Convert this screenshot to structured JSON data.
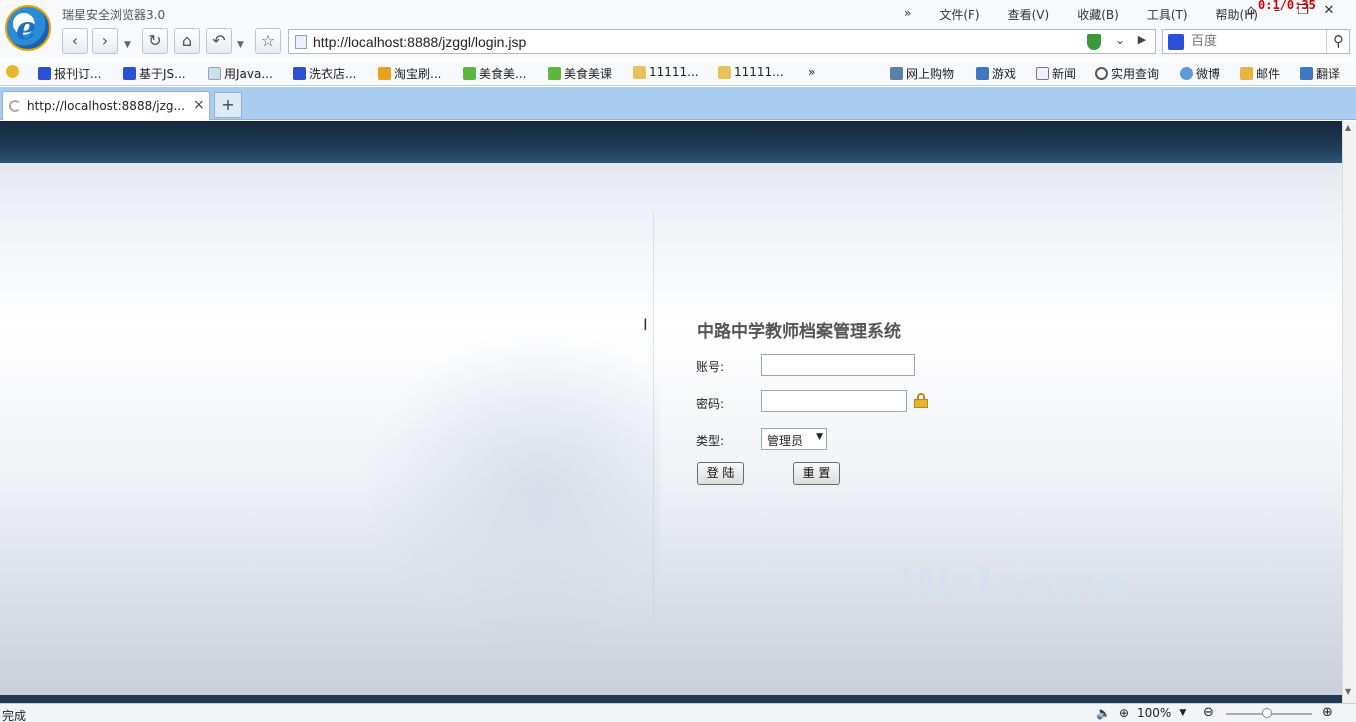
{
  "browser": {
    "app_title": "瑞星安全浏览器3.0",
    "timer": "0:1/0:35",
    "menu": [
      "文件(F)",
      "查看(V)",
      "收藏(B)",
      "工具(T)",
      "帮助(H)"
    ],
    "more_menu": "»",
    "address": "http://localhost:8888/jzggl/login.jsp",
    "search_placeholder": "百度"
  },
  "bookmarks": [
    {
      "label": "报刊订...",
      "icon": "paw-icon",
      "color": "#2b4fd6"
    },
    {
      "label": "基于JS...",
      "icon": "paw-icon",
      "color": "#2b4fd6"
    },
    {
      "label": "用Java...",
      "icon": "page-icon",
      "color": "#9bb"
    },
    {
      "label": "洗衣店...",
      "icon": "paw-icon",
      "color": "#2b4fd6"
    },
    {
      "label": "淘宝刷...",
      "icon": "bird-icon",
      "color": "#e9a21a"
    },
    {
      "label": "美食美...",
      "icon": "iqiyi-icon",
      "color": "#5bb83a"
    },
    {
      "label": "美食美课",
      "icon": "iqiyi-icon",
      "color": "#5bb83a"
    },
    {
      "label": "11111...",
      "icon": "folder-icon",
      "color": "#e8c25a"
    },
    {
      "label": "11111...",
      "icon": "folder-icon",
      "color": "#e8c25a"
    }
  ],
  "bookmarks_more": "»",
  "quick_links": [
    {
      "label": "网上购物",
      "icon": "cart-icon"
    },
    {
      "label": "游戏",
      "icon": "gamepad-icon"
    },
    {
      "label": "新闻",
      "icon": "news-icon"
    },
    {
      "label": "实用查询",
      "icon": "search-icon"
    },
    {
      "label": "微博",
      "icon": "weibo-icon"
    },
    {
      "label": "邮件",
      "icon": "mail-icon"
    },
    {
      "label": "翻译",
      "icon": "translate-icon"
    }
  ],
  "tab": {
    "title": "http://localhost:8888/jzg...",
    "close": "×",
    "new_tab": "+"
  },
  "login": {
    "title": "中路中学教师档案管理系统",
    "account_label": "账号:",
    "account_value": "",
    "password_label": "密码:",
    "password_value": "",
    "type_label": "类型:",
    "type_selected": "管理员",
    "login_button": "登 陆",
    "reset_button": "重 置"
  },
  "watermark": "Welcome",
  "status": {
    "text": "完成",
    "zoom": "100%"
  }
}
